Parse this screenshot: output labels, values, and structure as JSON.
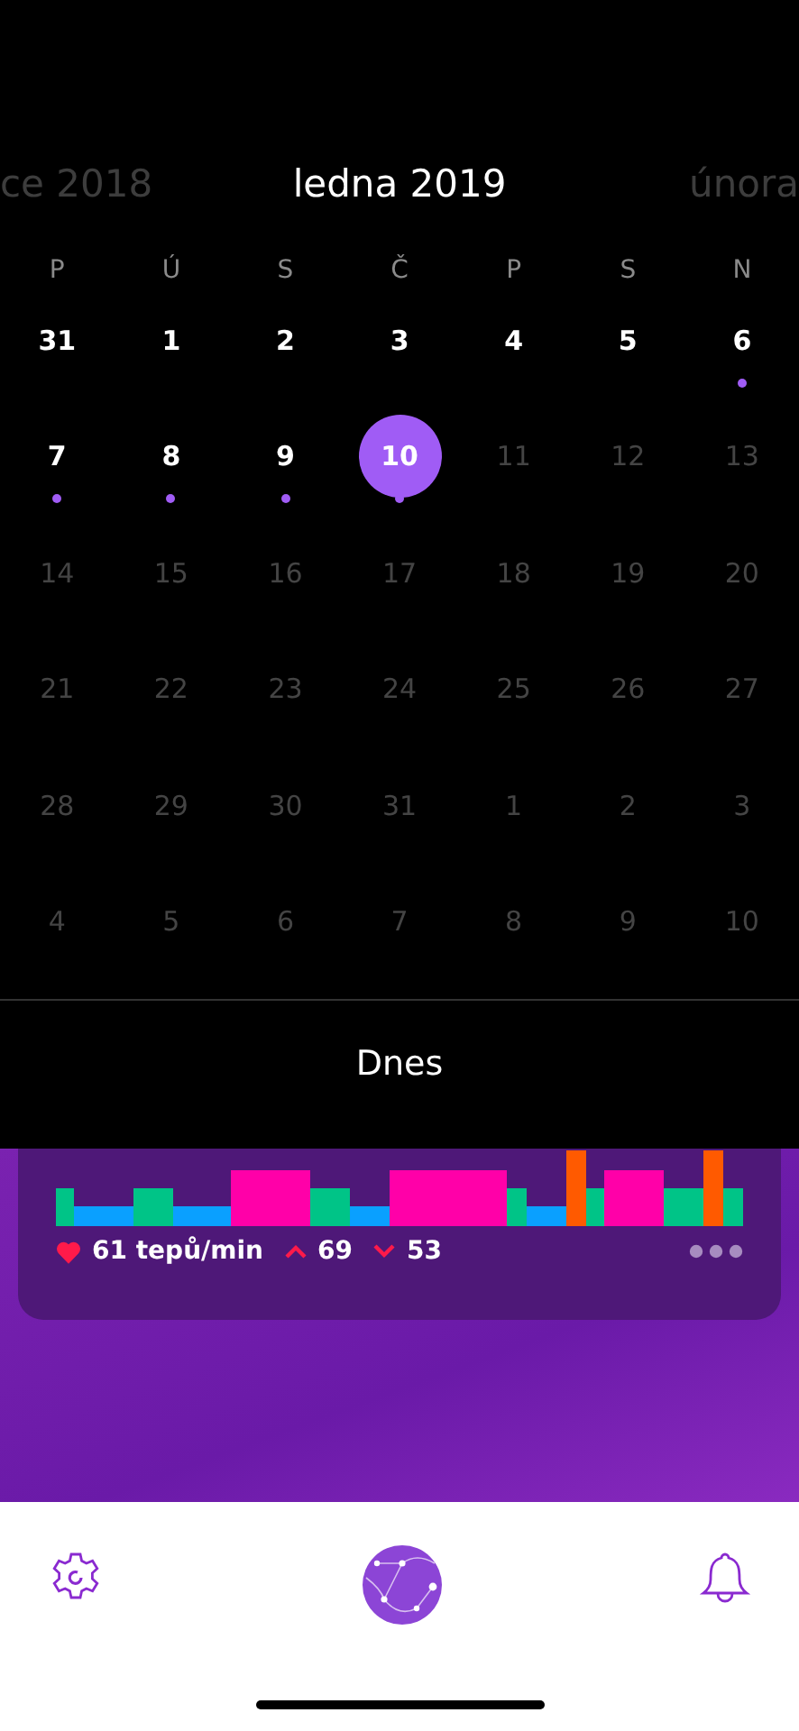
{
  "month_nav": {
    "previous": "ce 2018",
    "current": "ledna 2019",
    "next": "února"
  },
  "weekdays": [
    "P",
    "Ú",
    "S",
    "Č",
    "P",
    "S",
    "N"
  ],
  "days": [
    {
      "label": "31",
      "muted": false,
      "dot": false,
      "selected": false
    },
    {
      "label": "1",
      "muted": false,
      "dot": false,
      "selected": false
    },
    {
      "label": "2",
      "muted": false,
      "dot": false,
      "selected": false
    },
    {
      "label": "3",
      "muted": false,
      "dot": false,
      "selected": false
    },
    {
      "label": "4",
      "muted": false,
      "dot": false,
      "selected": false
    },
    {
      "label": "5",
      "muted": false,
      "dot": false,
      "selected": false
    },
    {
      "label": "6",
      "muted": false,
      "dot": true,
      "selected": false
    },
    {
      "label": "7",
      "muted": false,
      "dot": true,
      "selected": false
    },
    {
      "label": "8",
      "muted": false,
      "dot": true,
      "selected": false
    },
    {
      "label": "9",
      "muted": false,
      "dot": true,
      "selected": false
    },
    {
      "label": "10",
      "muted": false,
      "dot": true,
      "selected": true
    },
    {
      "label": "11",
      "muted": true,
      "dot": false,
      "selected": false
    },
    {
      "label": "12",
      "muted": true,
      "dot": false,
      "selected": false
    },
    {
      "label": "13",
      "muted": true,
      "dot": false,
      "selected": false
    },
    {
      "label": "14",
      "muted": true,
      "dot": false,
      "selected": false
    },
    {
      "label": "15",
      "muted": true,
      "dot": false,
      "selected": false
    },
    {
      "label": "16",
      "muted": true,
      "dot": false,
      "selected": false
    },
    {
      "label": "17",
      "muted": true,
      "dot": false,
      "selected": false
    },
    {
      "label": "18",
      "muted": true,
      "dot": false,
      "selected": false
    },
    {
      "label": "19",
      "muted": true,
      "dot": false,
      "selected": false
    },
    {
      "label": "20",
      "muted": true,
      "dot": false,
      "selected": false
    },
    {
      "label": "21",
      "muted": true,
      "dot": false,
      "selected": false
    },
    {
      "label": "22",
      "muted": true,
      "dot": false,
      "selected": false
    },
    {
      "label": "23",
      "muted": true,
      "dot": false,
      "selected": false
    },
    {
      "label": "24",
      "muted": true,
      "dot": false,
      "selected": false
    },
    {
      "label": "25",
      "muted": true,
      "dot": false,
      "selected": false
    },
    {
      "label": "26",
      "muted": true,
      "dot": false,
      "selected": false
    },
    {
      "label": "27",
      "muted": true,
      "dot": false,
      "selected": false
    },
    {
      "label": "28",
      "muted": true,
      "dot": false,
      "selected": false
    },
    {
      "label": "29",
      "muted": true,
      "dot": false,
      "selected": false
    },
    {
      "label": "30",
      "muted": true,
      "dot": false,
      "selected": false
    },
    {
      "label": "31",
      "muted": true,
      "dot": false,
      "selected": false
    },
    {
      "label": "1",
      "muted": true,
      "dot": false,
      "selected": false
    },
    {
      "label": "2",
      "muted": true,
      "dot": false,
      "selected": false
    },
    {
      "label": "3",
      "muted": true,
      "dot": false,
      "selected": false
    },
    {
      "label": "4",
      "muted": true,
      "dot": false,
      "selected": false
    },
    {
      "label": "5",
      "muted": true,
      "dot": false,
      "selected": false
    },
    {
      "label": "6",
      "muted": true,
      "dot": false,
      "selected": false
    },
    {
      "label": "7",
      "muted": true,
      "dot": false,
      "selected": false
    },
    {
      "label": "8",
      "muted": true,
      "dot": false,
      "selected": false
    },
    {
      "label": "9",
      "muted": true,
      "dot": false,
      "selected": false
    },
    {
      "label": "10",
      "muted": true,
      "dot": false,
      "selected": false
    }
  ],
  "today_button": "Dnes",
  "heart_card": {
    "rate": "61 tepů/min",
    "max": "69",
    "min": "53"
  }
}
